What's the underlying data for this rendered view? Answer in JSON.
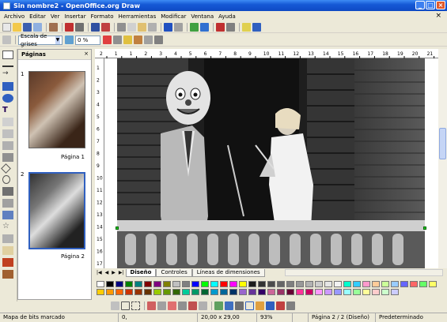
{
  "window": {
    "title": "Sin nombre2 - OpenOffice.org Draw"
  },
  "menu": [
    "Archivo",
    "Editar",
    "Ver",
    "Insertar",
    "Formato",
    "Herramientas",
    "Modificar",
    "Ventana",
    "Ayuda"
  ],
  "toolbar2": {
    "color_mode": "Escala de grises",
    "transparency": "0 %"
  },
  "pages_panel": {
    "title": "Páginas",
    "pages": [
      {
        "number": "1",
        "label": "Página 1"
      },
      {
        "number": "2",
        "label": "Página 2"
      }
    ]
  },
  "ruler": {
    "h_ticks": [
      "2",
      "1",
      "1",
      "2",
      "3",
      "4",
      "5",
      "6",
      "7",
      "8",
      "9",
      "10",
      "11",
      "12",
      "13",
      "14",
      "15",
      "16",
      "17",
      "18",
      "19",
      "20",
      "21"
    ],
    "v_ticks": [
      "1",
      "2",
      "3",
      "4",
      "5",
      "6",
      "7",
      "8",
      "9",
      "10",
      "11",
      "12",
      "13",
      "14",
      "15",
      "16",
      "17"
    ]
  },
  "layer_tabs": [
    "Diseño",
    "Controles",
    "Líneas de dimensiones"
  ],
  "statusbar": {
    "mode": "Mapa de bits marcado",
    "position": "0,",
    "size": "20,00 x 29,00",
    "zoom": "93%",
    "page": "Página 2 / 2 (Diseño)",
    "style": "Predeterminado"
  },
  "colors": {
    "palette": [
      "#ffffff",
      "#000000",
      "#000080",
      "#008000",
      "#008080",
      "#800000",
      "#800080",
      "#808000",
      "#c0c0c0",
      "#808080",
      "#0000ff",
      "#00ff00",
      "#00ffff",
      "#ff0000",
      "#ff00ff",
      "#ffff00",
      "#1c1c1c",
      "#333333",
      "#4c4c4c",
      "#666666",
      "#7f7f7f",
      "#999999",
      "#b2b2b2",
      "#cccccc",
      "#e5e5e5",
      "#f2f2f2",
      "#00ffcc",
      "#33ccff",
      "#ff99cc",
      "#ffcc99",
      "#ccff99",
      "#99ccff",
      "#6666ff",
      "#ff6666",
      "#66ff66",
      "#ffff66",
      "#ffcc00",
      "#ff9900",
      "#ff6600",
      "#cc3300",
      "#993300",
      "#663300",
      "#99cc00",
      "#669900",
      "#336600",
      "#00cc99",
      "#009966",
      "#006633",
      "#0099cc",
      "#006699",
      "#003366",
      "#9966cc",
      "#663399",
      "#330066",
      "#cc6699",
      "#993366",
      "#660033",
      "#ff3399",
      "#cc0066",
      "#ff99ff",
      "#cc99ff",
      "#9999ff",
      "#99ffff",
      "#99ff99",
      "#ffff99",
      "#ffcccc",
      "#ccffcc",
      "#ccccff"
    ]
  }
}
